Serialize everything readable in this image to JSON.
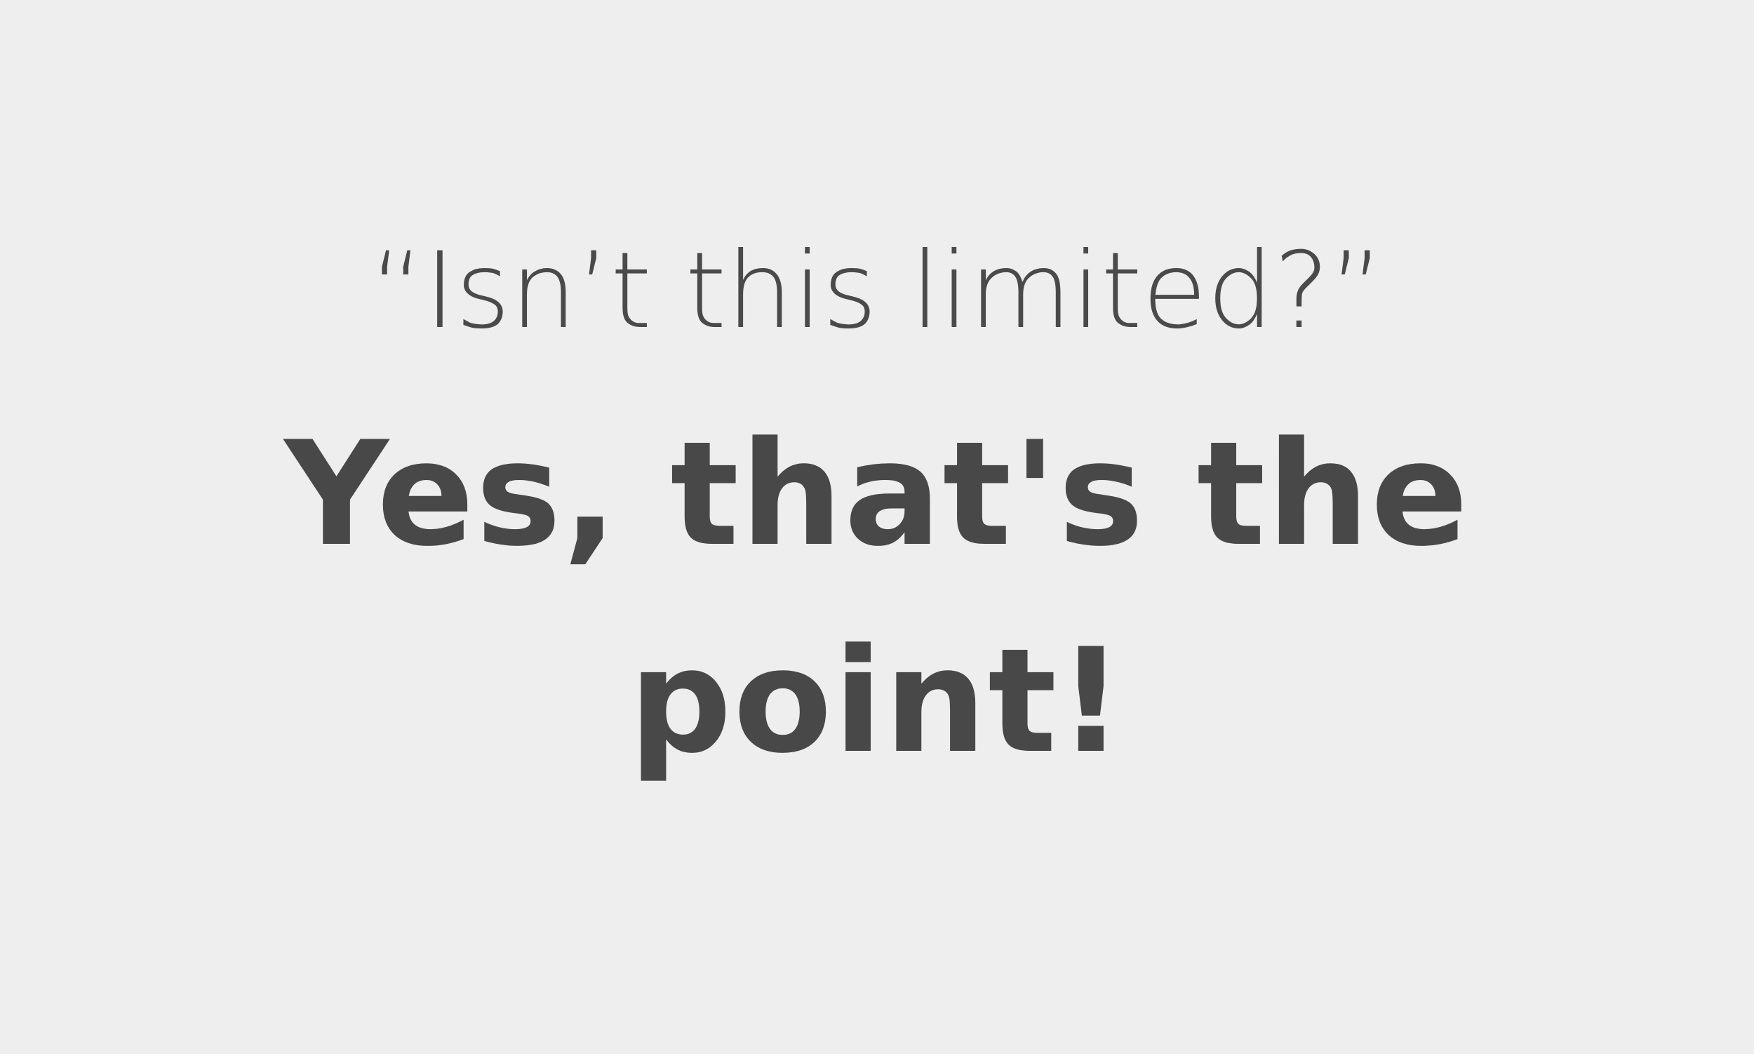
{
  "slide": {
    "question": "“Isn’t this limited?”",
    "answer_line1": "Yes, that's the",
    "answer_line2": "point!"
  }
}
